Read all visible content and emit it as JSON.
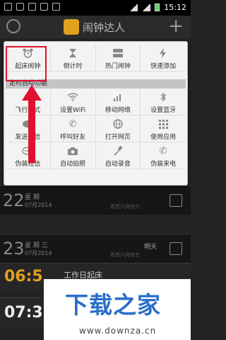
{
  "status_bar": {
    "time": "15:12"
  },
  "app": {
    "title": "闹钟达人"
  },
  "popup": {
    "section_title": "定时自动功能",
    "top_row": [
      {
        "label": "起床闹钟",
        "icon": "alarm-clock-icon"
      },
      {
        "label": "倒计时",
        "icon": "hourglass-icon"
      },
      {
        "label": "热门闹钟",
        "icon": "hot-alarm-icon"
      },
      {
        "label": "快速添加",
        "icon": "lightning-icon"
      }
    ],
    "grid": [
      {
        "label": "飞行模式",
        "icon": "airplane-icon"
      },
      {
        "label": "设置WiFi",
        "icon": "wifi-icon"
      },
      {
        "label": "移动网络",
        "icon": "signal-icon"
      },
      {
        "label": "设置蓝牙",
        "icon": "bluetooth-icon"
      },
      {
        "label": "发送短信",
        "icon": "sms-icon"
      },
      {
        "label": "呼叫好友",
        "icon": "phone-icon"
      },
      {
        "label": "打开网页",
        "icon": "globe-icon"
      },
      {
        "label": "使用应用",
        "icon": "apps-grid-icon"
      },
      {
        "label": "伪装短信",
        "icon": "fake-sms-icon"
      },
      {
        "label": "自动拍照",
        "icon": "camera-icon"
      },
      {
        "label": "自动录音",
        "icon": "microphone-icon"
      },
      {
        "label": "伪装来电",
        "icon": "fake-call-icon"
      }
    ]
  },
  "list": {
    "rows": [
      {
        "day": "22",
        "weekday": "星 期",
        "date": "07月2014",
        "note": "农历六月廿六",
        "tag": ""
      },
      {
        "day": "23",
        "weekday": "星 期 三",
        "date": "07月2014",
        "note": "农历六月廿七",
        "tag": "明天"
      }
    ],
    "alarms": [
      {
        "time": "06:5",
        "name": "工作日起床"
      },
      {
        "time": "07:3",
        "name": ""
      }
    ]
  },
  "watermark": {
    "title": "下载之家",
    "url": "www.downza.cn"
  },
  "colors": {
    "highlight": "#e01030",
    "accent": "#e0a020",
    "watermark_blue": "#2a6fc9"
  }
}
